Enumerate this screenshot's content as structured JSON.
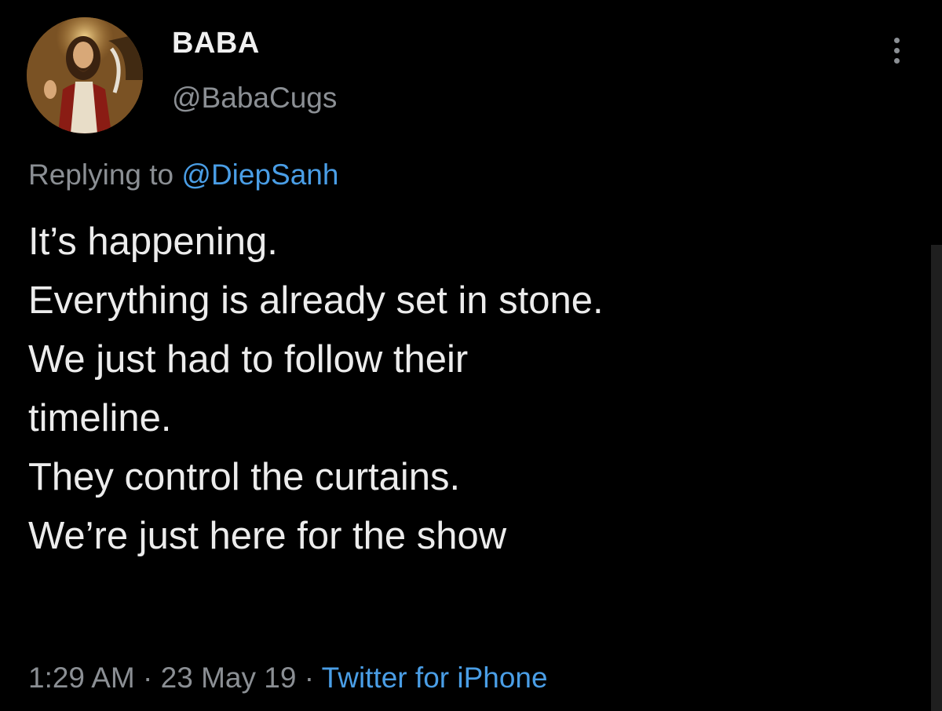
{
  "tweet": {
    "display_name": "BABA",
    "handle": "@BabaCugs",
    "avatar_icon": "religious-portrait-avatar",
    "more_icon": "more-vertical-icon",
    "replying_prefix": "Replying to",
    "replying_mention": "@DiepSanh",
    "text_lines": [
      "It’s happening.",
      "Everything is already set in stone.",
      "We just had to follow their",
      "timeline.",
      "They control the curtains.",
      "We’re just here for the show"
    ],
    "time": "1:29 AM",
    "separator": "·",
    "date": "23 May 19",
    "source": "Twitter for iPhone"
  },
  "colors": {
    "background": "#000000",
    "text_primary": "#ececec",
    "text_secondary": "#8b8f94",
    "link": "#4a9ee6"
  }
}
